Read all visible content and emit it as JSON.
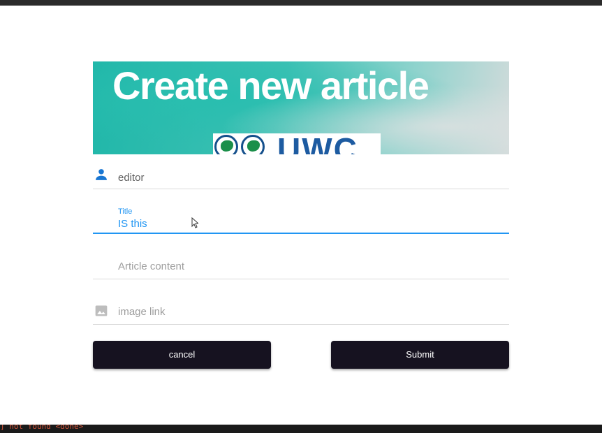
{
  "banner": {
    "title": "Create new article",
    "logo_text": "UWC"
  },
  "form": {
    "author": {
      "value": "editor",
      "icon": "person-icon"
    },
    "title": {
      "label": "Title",
      "value": "IS this"
    },
    "content": {
      "placeholder": "Article content"
    },
    "image": {
      "placeholder": "image link",
      "icon": "image-icon"
    }
  },
  "buttons": {
    "cancel_label": "cancel",
    "submit_label": "Submit"
  },
  "terminal": {
    "text": "] not found <done>"
  },
  "colors": {
    "accent": "#2196f3",
    "button_bg": "#161220",
    "icon_blue": "#1976d2"
  }
}
